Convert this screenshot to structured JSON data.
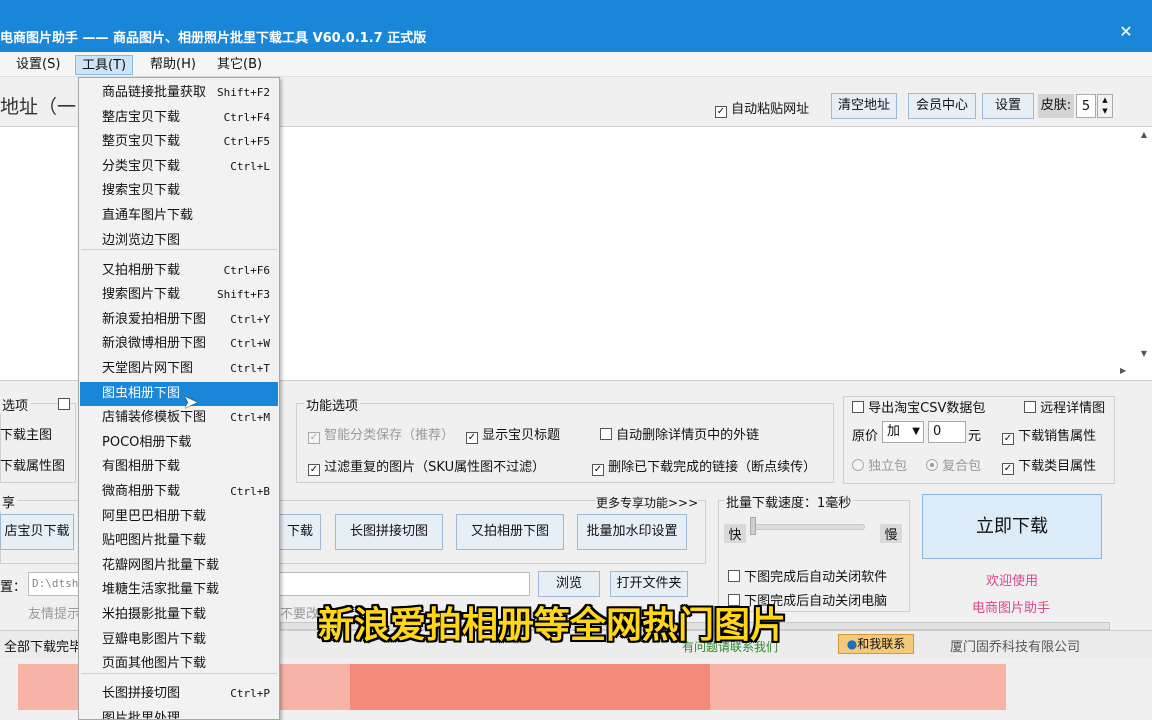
{
  "window": {
    "title": "电商图片助手 —— 商品图片、相册照片批里下载工具 V60.0.1.7 正式版",
    "close_glyph": "✕"
  },
  "menubar": {
    "items": [
      "设置(S)",
      "工具(T)",
      "帮助(H)",
      "其它(B)"
    ],
    "active": "工具(T)"
  },
  "url": {
    "label": "地址（一",
    "auto_paste": "自动粘贴网址",
    "auto_paste_checked": true,
    "clear_button": "清空地址",
    "member_button": "会员中心",
    "settings_button": "设置",
    "skin_label": "皮肤:",
    "skin_value": "5"
  },
  "tools_menu": {
    "items": [
      {
        "label": "商品链接批量获取",
        "shortcut": "Shift+F2"
      },
      {
        "label": "整店宝贝下载",
        "shortcut": "Ctrl+F4"
      },
      {
        "label": "整页宝贝下载",
        "shortcut": "Ctrl+F5"
      },
      {
        "label": "分类宝贝下载",
        "shortcut": "Ctrl+L"
      },
      {
        "label": "搜索宝贝下载",
        "shortcut": ""
      },
      {
        "label": "直通车图片下载",
        "shortcut": ""
      },
      {
        "label": "边浏览边下图",
        "shortcut": ""
      },
      {
        "label": "又拍相册下载",
        "shortcut": "Ctrl+F6"
      },
      {
        "label": "搜索图片下载",
        "shortcut": "Shift+F3"
      },
      {
        "label": "新浪爱拍相册下图",
        "shortcut": "Ctrl+Y"
      },
      {
        "label": "新浪微博相册下图",
        "shortcut": "Ctrl+W"
      },
      {
        "label": "天堂图片网下图",
        "shortcut": "Ctrl+T"
      },
      {
        "label": "图虫相册下图",
        "shortcut": ""
      },
      {
        "label": "店铺装修模板下图",
        "shortcut": "Ctrl+M"
      },
      {
        "label": "POCO相册下载",
        "shortcut": ""
      },
      {
        "label": "有图相册下载",
        "shortcut": ""
      },
      {
        "label": "微商相册下载",
        "shortcut": "Ctrl+B"
      },
      {
        "label": "阿里巴巴相册下载",
        "shortcut": ""
      },
      {
        "label": "贴吧图片批量下载",
        "shortcut": ""
      },
      {
        "label": "花瓣网图片批量下载",
        "shortcut": ""
      },
      {
        "label": "堆糖生活家批量下载",
        "shortcut": ""
      },
      {
        "label": "米拍摄影批量下载",
        "shortcut": ""
      },
      {
        "label": "豆瓣电影图片下载",
        "shortcut": ""
      },
      {
        "label": "页面其他图片下载",
        "shortcut": ""
      },
      {
        "label": "长图拼接切图",
        "shortcut": "Ctrl+P"
      },
      {
        "label": "图片批里处理",
        "shortcut": ""
      }
    ],
    "highlighted": "图虫相册下图"
  },
  "left_options": {
    "group_label": "选项",
    "item1": "下载主图",
    "item2": "下载属性图"
  },
  "function_options": {
    "group_label": "功能选项",
    "smart_classify": "智能分类保存（推荐）",
    "show_title": "显示宝贝标题",
    "auto_remove_links": "自动删除详情页中的外链",
    "filter_duplicates": "过滤重复的图片（SKU属性图不过滤）",
    "delete_completed": "删除已下载完成的链接（断点续传）"
  },
  "right_options": {
    "export_csv": "导出淘宝CSV数据包",
    "remote_detail": "远程详情图",
    "price_label": "原价",
    "price_op": "加",
    "price_value": "0",
    "price_unit": "元",
    "download_sales_attr": "下载销售属性",
    "single_pack": "独立包",
    "combined_pack": "复合包",
    "download_category_attr": "下载类目属性"
  },
  "features": {
    "group_label": "享",
    "more_link": "更多专享功能>>>",
    "buttons": [
      "店宝贝下载",
      "下载",
      "长图拼接切图",
      "又拍相册下图",
      "批量加水印设置"
    ]
  },
  "speed": {
    "label": "批量下载速度：1毫秒",
    "fast": "快",
    "slow": "慢",
    "value_ms": 1,
    "close_software": "下图完成后自动关闭软件",
    "close_computer": "下图完成后自动关闭电脑"
  },
  "download": {
    "button": "立即下载",
    "welcome_1": "欢迎使用",
    "welcome_2": "电商图片助手"
  },
  "path": {
    "label": "置：",
    "value": "D:\\dtsh",
    "browse": "浏览",
    "open_folder": "打开文件夹",
    "hint": "友情提示",
    "hint_tail": "不要改"
  },
  "status": {
    "text": "全部下载完毕",
    "center_text": "有问题请联系我们",
    "contact_button": "和我联系",
    "company": "厦门固乔科技有限公司"
  },
  "subtitle": "新浪爱拍相册等全网热门图片",
  "colors": {
    "title_bar": "#1a86d8",
    "highlight": "#1a86d8",
    "welcome_pink": "#d9468c",
    "subtitle_yellow": "#ffd61a"
  }
}
